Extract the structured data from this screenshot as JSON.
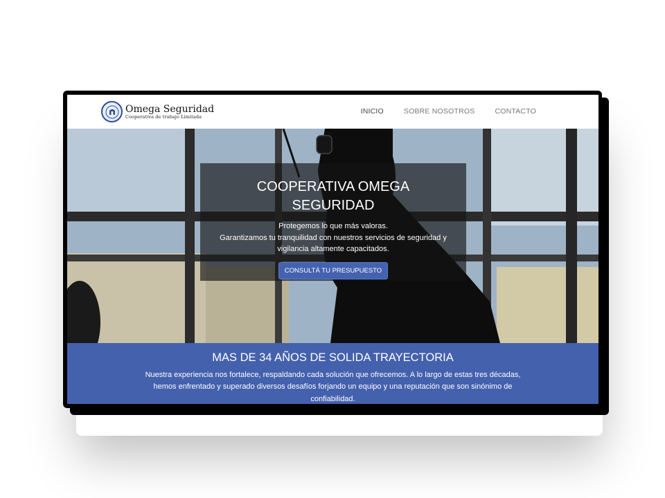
{
  "brand": {
    "name": "Omega Seguridad",
    "tagline": "Cooperativa de trabajo Limitada"
  },
  "nav": {
    "items": [
      {
        "label": "INICIO"
      },
      {
        "label": "SOBRE NOSOTROS"
      },
      {
        "label": "CONTACTO"
      }
    ]
  },
  "hero": {
    "title": "COOPERATIVA OMEGA SEGURIDAD",
    "line1": "Protegemos lo que más valoras.",
    "line2": "Garantizamos tu tranquilidad con nuestros servicios de seguridad y vigilancia altamente capacitados.",
    "button_label": "CONSULTÁ TU PRESUPUESTO"
  },
  "band": {
    "title": "MAS DE 34 AÑOS DE SOLIDA TRAYECTORIA",
    "text": "Nuestra experiencia nos fortalece, respaldando cada solución que ofrecemos. A lo largo de estas tres décadas, hemos enfrentado y superado diversos desafíos forjando un equipo y una reputación que son sinónimo de confiabilidad."
  },
  "colors": {
    "accent": "#4461ad",
    "button": "#4462b0"
  },
  "icons": {
    "logo": "shield-emblem-icon"
  }
}
